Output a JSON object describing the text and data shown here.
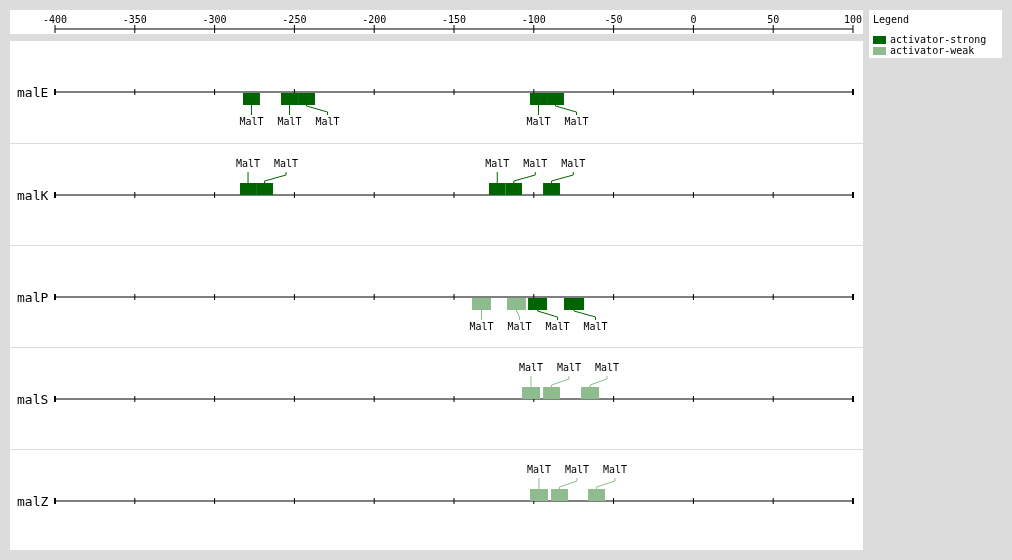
{
  "axis": {
    "ticks": [
      "-400",
      "-350",
      "-300",
      "-250",
      "-200",
      "-150",
      "-100",
      "-50",
      "0",
      "50",
      "100"
    ]
  },
  "tracks": [
    {
      "gene": "malE",
      "sites": [
        {
          "label": "MalT",
          "color": "#006400"
        },
        {
          "label": "MalT",
          "color": "#006400"
        },
        {
          "label": "MalT",
          "color": "#006400"
        },
        {
          "label": "MalT",
          "color": "#006400"
        },
        {
          "label": "MalT",
          "color": "#006400"
        }
      ]
    },
    {
      "gene": "malK",
      "sites": [
        {
          "label": "MalT",
          "color": "#006400"
        },
        {
          "label": "MalT",
          "color": "#006400"
        },
        {
          "label": "MalT",
          "color": "#006400"
        },
        {
          "label": "MalT",
          "color": "#006400"
        },
        {
          "label": "MalT",
          "color": "#006400"
        }
      ]
    },
    {
      "gene": "malP",
      "sites": [
        {
          "label": "MalT",
          "color": "#8fbc8f"
        },
        {
          "label": "MalT",
          "color": "#8fbc8f"
        },
        {
          "label": "MalT",
          "color": "#006400"
        },
        {
          "label": "MalT",
          "color": "#006400"
        }
      ]
    },
    {
      "gene": "malS",
      "sites": [
        {
          "label": "MalT",
          "color": "#8fbc8f"
        },
        {
          "label": "MalT",
          "color": "#8fbc8f"
        },
        {
          "label": "MalT",
          "color": "#8fbc8f"
        }
      ]
    },
    {
      "gene": "malZ",
      "sites": [
        {
          "label": "MalT",
          "color": "#8fbc8f"
        },
        {
          "label": "MalT",
          "color": "#8fbc8f"
        },
        {
          "label": "MalT",
          "color": "#8fbc8f"
        }
      ]
    }
  ],
  "legend": {
    "title": "Legend",
    "items": [
      {
        "label": "activator-strong",
        "color": "#006400"
      },
      {
        "label": "activator-weak",
        "color": "#8fbc8f"
      }
    ]
  }
}
